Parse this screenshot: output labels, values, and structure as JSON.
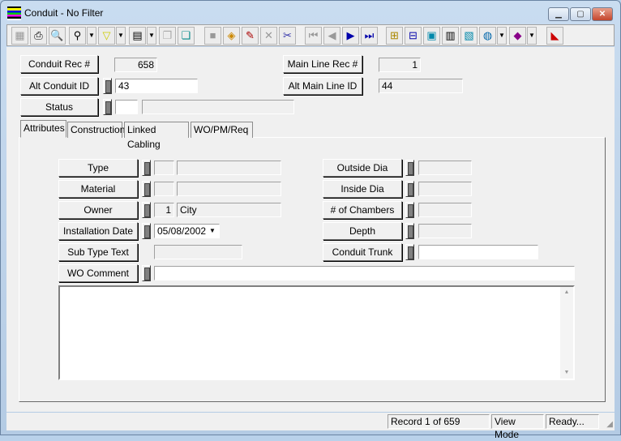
{
  "window": {
    "title": "Conduit - No Filter",
    "minimize": "▁",
    "maximize": "▢",
    "close": "✕"
  },
  "toolbar": {
    "icons": [
      "grid-icon",
      "print-icon",
      "preview-icon",
      "find-icon",
      "filter-icon",
      "report-icon",
      "copy-icon",
      "export-icon",
      "save-icon",
      "new-record-icon",
      "edit-icon",
      "delete-icon",
      "cut-icon",
      "first-record-icon",
      "previous-record-icon",
      "next-record-icon",
      "last-record-icon",
      "tree-icon",
      "hierarchy-icon",
      "map-icon",
      "calculator-icon",
      "chart-icon",
      "globe-icon",
      "book-icon",
      "exit-icon"
    ]
  },
  "header": {
    "conduit_rec_label": "Conduit Rec #",
    "conduit_rec_value": "658",
    "main_line_rec_label": "Main Line Rec #",
    "main_line_rec_value": "1",
    "alt_conduit_label": "Alt Conduit ID",
    "alt_conduit_value": "43",
    "alt_main_line_label": "Alt Main Line ID",
    "alt_main_line_value": "44",
    "status_label": "Status",
    "status_code": "",
    "status_desc": ""
  },
  "tabs": [
    {
      "label": "Attributes",
      "active": true
    },
    {
      "label": "Construction"
    },
    {
      "label": "Linked Cabling"
    },
    {
      "label": "WO/PM/Req"
    }
  ],
  "attributes": {
    "type_label": "Type",
    "type_code": "",
    "type_desc": "",
    "material_label": "Material",
    "material_code": "",
    "material_desc": "",
    "owner_label": "Owner",
    "owner_code": "1",
    "owner_desc": "City",
    "install_label": "Installation Date",
    "install_value": "05/08/2002",
    "subtype_label": "Sub Type Text",
    "subtype_value": "",
    "wo_comment_label": "WO Comment",
    "wo_comment_value": "",
    "memo": "",
    "outside_label": "Outside Dia",
    "outside_value": "",
    "inside_label": "Inside Dia",
    "inside_value": "",
    "chambers_label": "# of Chambers",
    "chambers_value": "",
    "depth_label": "Depth",
    "depth_value": "",
    "trunk_label": "Conduit Trunk",
    "trunk_value": ""
  },
  "statusbar": {
    "record": "Record 1 of 659",
    "mode": "View Mode",
    "state": "Ready..."
  }
}
